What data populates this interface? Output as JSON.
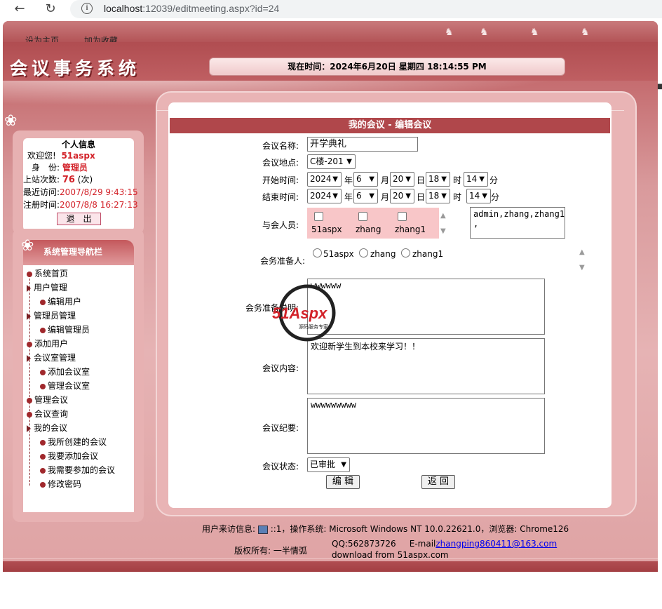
{
  "browser": {
    "url_host": "localhost",
    "url_rest": ":12039/editmeeting.aspx?id=24"
  },
  "top_links": [
    "设为主页",
    "加为收藏"
  ],
  "logo": "会议事务系统",
  "time_label": "现在时间：2024年6月20日 星期四 18:14:55 PM",
  "user_info": {
    "title": "个人信息",
    "welcome_label": "欢迎您!",
    "welcome_name": "51aspx",
    "role_label": "身　份:",
    "role_value": "管理员",
    "visits_label": "上站次数:",
    "visits_value": "76",
    "visits_unit": "(次)",
    "last_visit_label": "最近访问:",
    "last_visit_value": "2007/8/29 9:43:15",
    "register_label": "注册时间:",
    "register_value": "2007/8/8 16:27:13",
    "logout": "退　出"
  },
  "nav": {
    "header": "系统管理导航栏",
    "items": [
      {
        "label": "系统首页",
        "level": 0,
        "kind": "bullet"
      },
      {
        "label": "用户管理",
        "level": 0,
        "kind": "tri"
      },
      {
        "label": "编辑用户",
        "level": 1,
        "kind": "bullet"
      },
      {
        "label": "管理员管理",
        "level": 0,
        "kind": "tri"
      },
      {
        "label": "编辑管理员",
        "level": 1,
        "kind": "bullet"
      },
      {
        "label": "添加用户",
        "level": 0,
        "kind": "bullet"
      },
      {
        "label": "会议室管理",
        "level": 0,
        "kind": "tri"
      },
      {
        "label": "添加会议室",
        "level": 1,
        "kind": "bullet"
      },
      {
        "label": "管理会议室",
        "level": 1,
        "kind": "bullet"
      },
      {
        "label": "管理会议",
        "level": 0,
        "kind": "bullet"
      },
      {
        "label": "会议查询",
        "level": 0,
        "kind": "bullet"
      },
      {
        "label": "我的会议",
        "level": 0,
        "kind": "tri"
      },
      {
        "label": "我所创建的会议",
        "level": 1,
        "kind": "bullet"
      },
      {
        "label": "我要添加会议",
        "level": 1,
        "kind": "bullet"
      },
      {
        "label": "我需要参加的会议",
        "level": 1,
        "kind": "bullet"
      },
      {
        "label": "修改密码",
        "level": 1,
        "kind": "bullet"
      }
    ]
  },
  "form": {
    "title": "我的会议 - 编辑会议",
    "name_label": "会议名称:",
    "name_value": "开学典礼",
    "place_label": "会议地点:",
    "place_value": "C楼-201",
    "start_label": "开始时间:",
    "start": {
      "year": "2024",
      "month": "6",
      "day": "20",
      "hour": "18",
      "minute": "14"
    },
    "end_label": "结束时间:",
    "end": {
      "year": "2024",
      "month": "6",
      "day": "20",
      "hour": "18",
      "minute": "14"
    },
    "units": {
      "year": "年",
      "month": "月",
      "day": "日",
      "hour": "时",
      "minute": "分"
    },
    "attendees_label": "与会人员:",
    "attendees": [
      "51aspx",
      "zhang",
      "zhang1"
    ],
    "attendees_text": "admin,zhang,zhang1\n,",
    "preparer_label": "会务准备人:",
    "preparers": [
      "51aspx",
      "zhang",
      "zhang1"
    ],
    "note_label": "会务准备说明:",
    "note_value": "wwwwww",
    "content_label": "会议内容:",
    "content_value": "欢迎新学生到本校来学习！！",
    "summary_label": "会议纪要:",
    "summary_value": "wwwwwwwww",
    "status_label": "会议状态:",
    "status_value": "已审批",
    "edit_button": "编 辑",
    "back_button": "返 回"
  },
  "watermark": {
    "brand": "51Aspx",
    "sub": "源码服务专家"
  },
  "footer": {
    "visitor_label": "用户来访信息:",
    "visitor_info": "::1，操作系统: Microsoft Windows NT 10.0.22621.0，浏览器: Chrome126",
    "copyright": "版权所有: 一半情弧",
    "qq": "QQ:562873726",
    "email_label": "E-mail",
    "email": "zhangping860411@163.com",
    "download": "download from 51aspx.com"
  }
}
